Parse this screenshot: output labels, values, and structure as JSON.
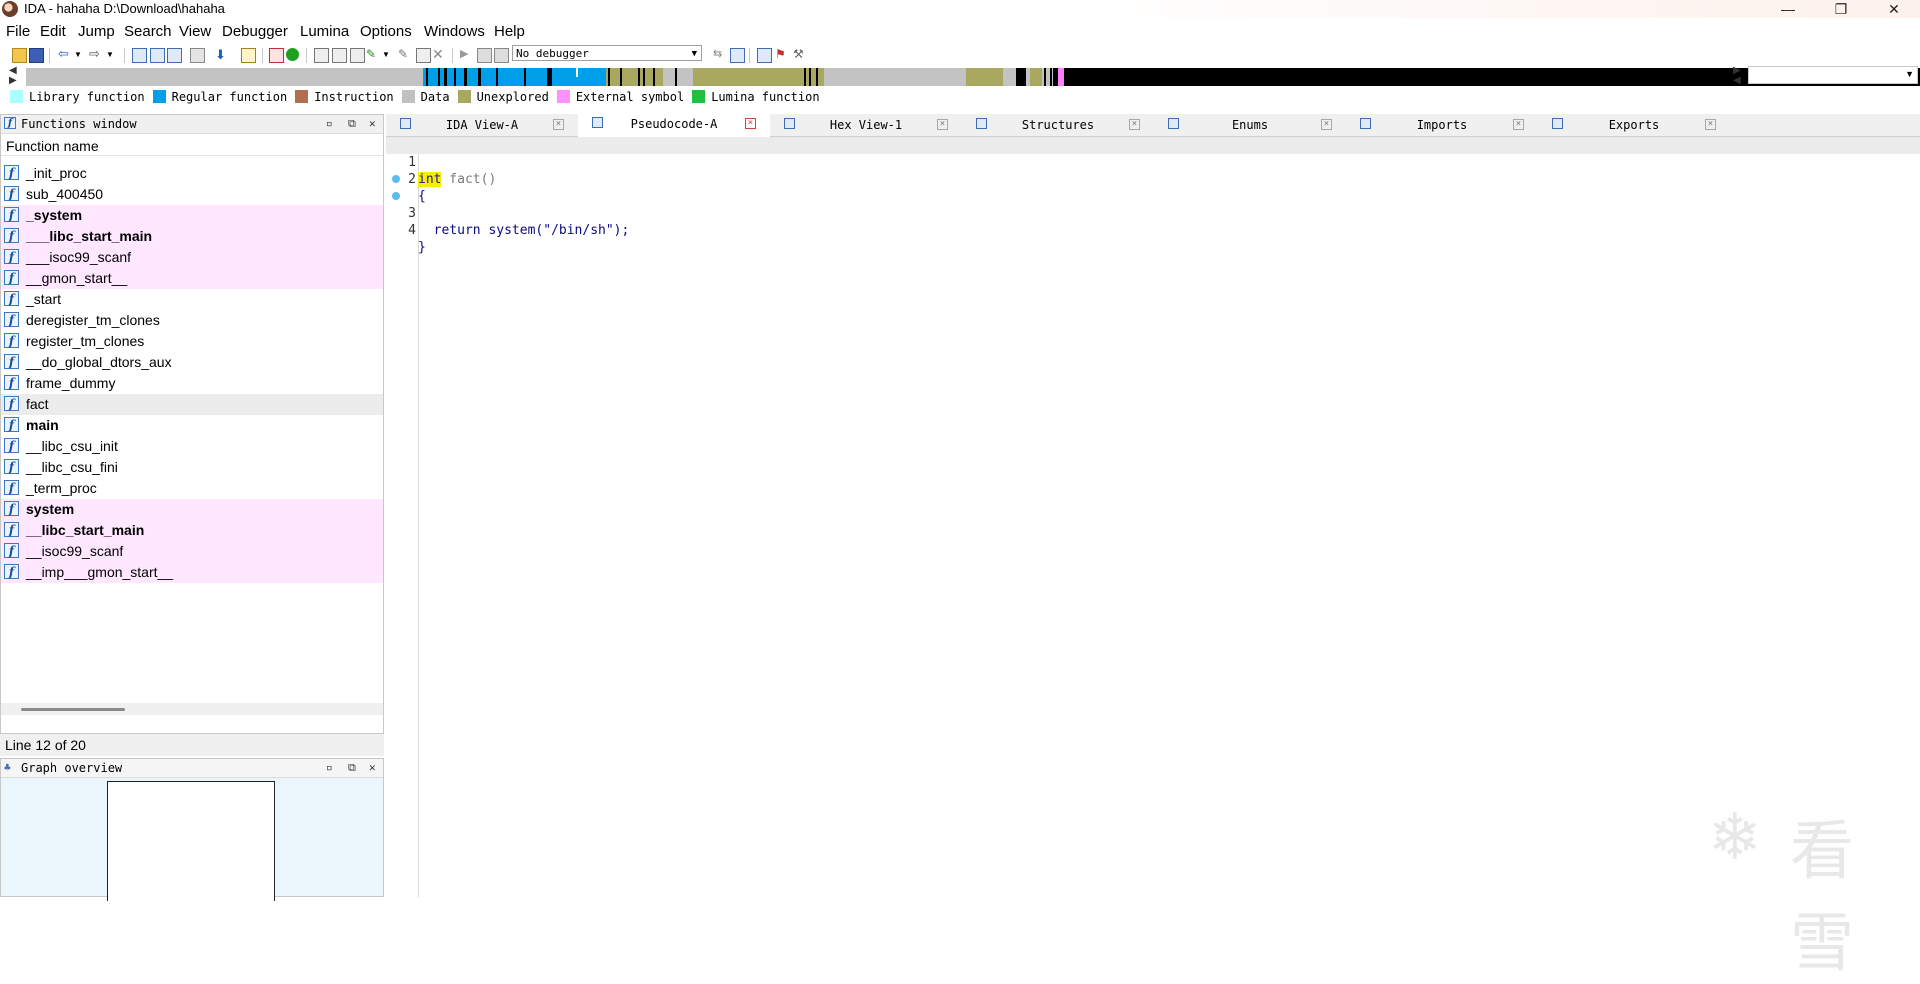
{
  "window": {
    "title": "IDA - hahaha D:\\Download\\hahaha",
    "minimize_glyph": "—",
    "maximize_glyph": "❐",
    "close_glyph": "✕"
  },
  "menu": [
    "File",
    "Edit",
    "Jump",
    "Search",
    "View",
    "Debugger",
    "Lumina",
    "Options",
    "Windows",
    "Help"
  ],
  "toolbar": {
    "debugger_select_value": "No debugger"
  },
  "legend": [
    {
      "label": "Library function",
      "color": "#aaffff"
    },
    {
      "label": "Regular function",
      "color": "#00a0e8"
    },
    {
      "label": "Instruction",
      "color": "#b07050"
    },
    {
      "label": "Data",
      "color": "#c0c0c0"
    },
    {
      "label": "Unexplored",
      "color": "#a8a860"
    },
    {
      "label": "External symbol",
      "color": "#ff90ff"
    },
    {
      "label": "Lumina function",
      "color": "#20c040"
    }
  ],
  "functions_window": {
    "title": "Functions window",
    "column_header": "Function name",
    "rows": [
      {
        "name": "_init_proc",
        "style": "normal"
      },
      {
        "name": "sub_400450",
        "style": "normal"
      },
      {
        "name": "_system",
        "style": "ext-bold"
      },
      {
        "name": "___libc_start_main",
        "style": "ext-bold"
      },
      {
        "name": "___isoc99_scanf",
        "style": "ext"
      },
      {
        "name": "__gmon_start__",
        "style": "ext"
      },
      {
        "name": "_start",
        "style": "normal"
      },
      {
        "name": "deregister_tm_clones",
        "style": "normal"
      },
      {
        "name": "register_tm_clones",
        "style": "normal"
      },
      {
        "name": "__do_global_dtors_aux",
        "style": "normal"
      },
      {
        "name": "frame_dummy",
        "style": "normal"
      },
      {
        "name": "fact",
        "style": "selected"
      },
      {
        "name": "main",
        "style": "bold"
      },
      {
        "name": "__libc_csu_init",
        "style": "normal"
      },
      {
        "name": "__libc_csu_fini",
        "style": "normal"
      },
      {
        "name": "_term_proc",
        "style": "normal"
      },
      {
        "name": "system",
        "style": "ext-bold"
      },
      {
        "name": "__libc_start_main",
        "style": "ext-bold"
      },
      {
        "name": "__isoc99_scanf",
        "style": "ext"
      },
      {
        "name": "__imp___gmon_start__",
        "style": "ext"
      }
    ],
    "status": "Line 12 of 20"
  },
  "graph_overview": {
    "title": "Graph overview"
  },
  "tabs": [
    {
      "label": "IDA View-A",
      "active": false
    },
    {
      "label": "Pseudocode-A",
      "active": true
    },
    {
      "label": "Hex View-1",
      "active": false
    },
    {
      "label": "Structures",
      "active": false
    },
    {
      "label": "Enums",
      "active": false
    },
    {
      "label": "Imports",
      "active": false
    },
    {
      "label": "Exports",
      "active": false
    }
  ],
  "pseudocode": {
    "line_numbers": [
      "1",
      "2",
      "3",
      "4"
    ],
    "line1_keyword": "int",
    "line1_rest": " fact()",
    "line2": "{",
    "line3_return": "  return ",
    "line3_call": "system(\"/bin/sh\");",
    "line4": "}"
  },
  "watermark": "看雪"
}
